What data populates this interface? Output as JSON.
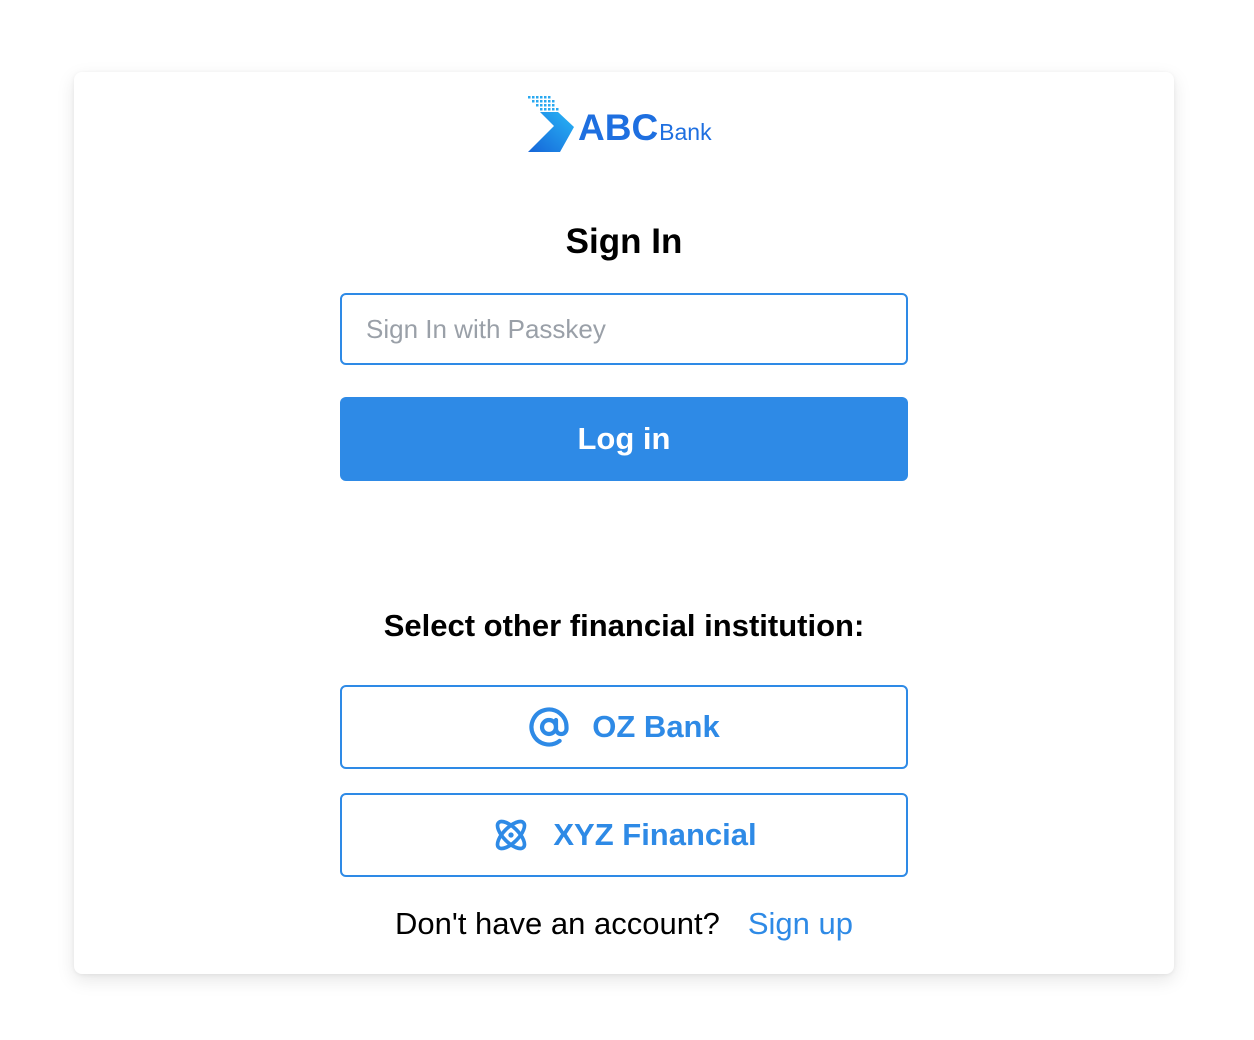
{
  "logo": {
    "brand_main": "ABC",
    "brand_sub": "Bank",
    "icon": "abc-bank-logo-icon"
  },
  "signin": {
    "title": "Sign In",
    "passkey_placeholder": "Sign In with Passkey",
    "passkey_value": "",
    "login_label": "Log in"
  },
  "institutions": {
    "heading": "Select other financial institution:",
    "items": [
      {
        "label": "OZ Bank",
        "icon": "at-sign-icon"
      },
      {
        "label": "XYZ Financial",
        "icon": "atom-icon"
      }
    ]
  },
  "footer": {
    "prompt": "Don't have an account?",
    "signup_label": "Sign up"
  },
  "colors": {
    "accent": "#2e8ae6",
    "brand": "#1e6fe0",
    "placeholder": "#9aa0a8"
  }
}
